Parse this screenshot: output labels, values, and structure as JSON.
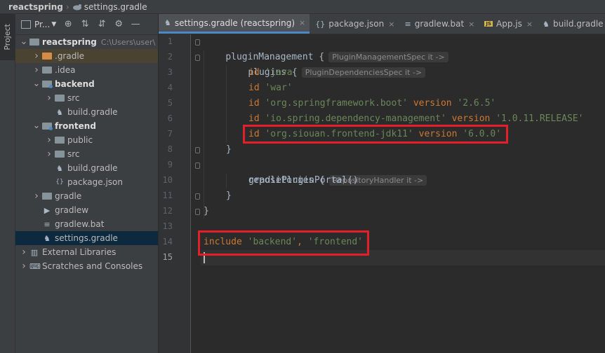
{
  "breadcrumb": {
    "project": "reactspring",
    "file": "settings.gradle"
  },
  "stripe": {
    "label": "Project"
  },
  "project_panel": {
    "dropdown_label": "Pr...",
    "tree": [
      {
        "label": "reactspring",
        "extra": "C:\\Users\\user\\",
        "indent": 0,
        "arrow": "down",
        "icon": "folder",
        "bold": true
      },
      {
        "label": ".gradle",
        "indent": 1,
        "arrow": "right",
        "icon": "folder-orange",
        "highlight": true
      },
      {
        "label": ".idea",
        "indent": 1,
        "arrow": "right",
        "icon": "folder"
      },
      {
        "label": "backend",
        "indent": 1,
        "arrow": "down",
        "icon": "folder-module",
        "bold": true
      },
      {
        "label": "src",
        "indent": 2,
        "arrow": "right",
        "icon": "folder"
      },
      {
        "label": "build.gradle",
        "indent": 2,
        "arrow": "none",
        "icon": "gradle"
      },
      {
        "label": "frontend",
        "indent": 1,
        "arrow": "down",
        "icon": "folder-module",
        "bold": true
      },
      {
        "label": "public",
        "indent": 2,
        "arrow": "right",
        "icon": "folder"
      },
      {
        "label": "src",
        "indent": 2,
        "arrow": "right",
        "icon": "folder"
      },
      {
        "label": "build.gradle",
        "indent": 2,
        "arrow": "none",
        "icon": "gradle"
      },
      {
        "label": "package.json",
        "indent": 2,
        "arrow": "none",
        "icon": "json"
      },
      {
        "label": "gradle",
        "indent": 1,
        "arrow": "right",
        "icon": "folder"
      },
      {
        "label": "gradlew",
        "indent": 1,
        "arrow": "none",
        "icon": "script"
      },
      {
        "label": "gradlew.bat",
        "indent": 1,
        "arrow": "none",
        "icon": "text"
      },
      {
        "label": "settings.gradle",
        "indent": 1,
        "arrow": "none",
        "icon": "gradle",
        "selected": true
      },
      {
        "label": "External Libraries",
        "indent": 0,
        "arrow": "right",
        "icon": "libraries"
      },
      {
        "label": "Scratches and Consoles",
        "indent": 0,
        "arrow": "right",
        "icon": "scratches"
      }
    ]
  },
  "tabs": [
    {
      "label": "settings.gradle (reactspring)",
      "icon": "gradle",
      "active": true
    },
    {
      "label": "package.json",
      "icon": "json"
    },
    {
      "label": "gradlew.bat",
      "icon": "text"
    },
    {
      "label": "App.js",
      "icon": "js"
    },
    {
      "label": "build.gradle (:fron",
      "icon": "gradle"
    }
  ],
  "editor": {
    "line_numbers": [
      "1",
      "2",
      "3",
      "4",
      "5",
      "6",
      "7",
      "8",
      "9",
      "10",
      "11",
      "12",
      "13",
      "14",
      "15"
    ],
    "current_line": 15,
    "hints": {
      "pluginManagement": "PluginManagementSpec it ->",
      "plugins": "PluginDependenciesSpec it ->",
      "repositories": "RepositoryHandler it ->"
    },
    "lines": {
      "l1": "pluginManagement {",
      "l2": "plugins {",
      "l3_kw": "id",
      "l3_str": "'java'",
      "l4_kw": "id",
      "l4_str": "'war'",
      "l5_kw": "id",
      "l5_str": "'org.springframework.boot'",
      "l5_ver": "version",
      "l5_vstr": "'2.6.5'",
      "l6_kw": "id",
      "l6_str": "'io.spring.dependency-management'",
      "l6_ver": "version",
      "l6_vstr": "'1.0.11.RELEASE'",
      "l7_kw": "id",
      "l7_str": "'org.siouan.frontend-jdk11'",
      "l7_ver": "version",
      "l7_vstr": "'6.0.0'",
      "l8": "}",
      "l9": "repositories {",
      "l10": "gradlePluginPortal()",
      "l11": "}",
      "l12": "}",
      "l14_kw": "include",
      "l14_s1": "'backend'",
      "l14_comma": ",",
      "l14_s2": "'frontend'"
    }
  },
  "colors": {
    "highlight_box": "#e3202a",
    "keyword": "#cc7832",
    "string": "#6a8759",
    "accent": "#4a88c7"
  }
}
